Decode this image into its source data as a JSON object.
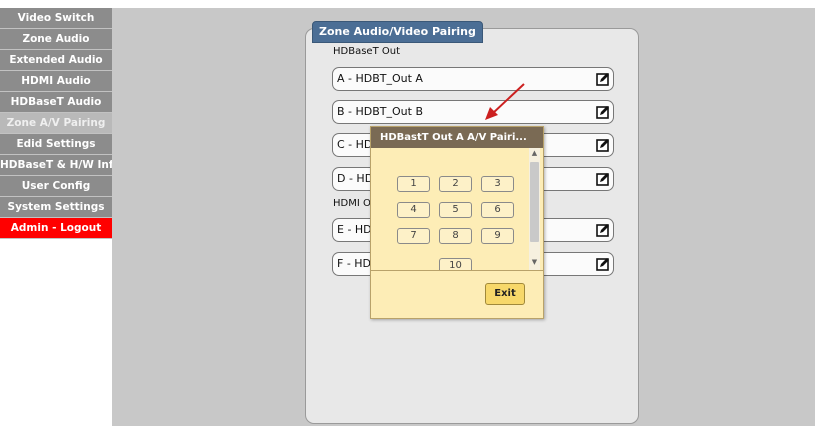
{
  "sidebar": {
    "items": [
      {
        "label": "Video Switch"
      },
      {
        "label": "Zone Audio"
      },
      {
        "label": "Extended Audio"
      },
      {
        "label": "HDMI Audio"
      },
      {
        "label": "HDBaseT Audio"
      },
      {
        "label": "Zone A/V Pairing",
        "active": true
      },
      {
        "label": "Edid Settings"
      },
      {
        "label": "HDBaseT & H/W Info"
      },
      {
        "label": "User Config"
      },
      {
        "label": "System Settings"
      },
      {
        "label": "Admin - Logout"
      }
    ]
  },
  "panel": {
    "title": "Zone Audio/Video Pairing",
    "hdbaset_section": "HDBaseT Out",
    "hdmi_section": "HDMI Ou",
    "rows": [
      {
        "label": "A - HDBT_Out A"
      },
      {
        "label": "B - HDBT_Out B"
      },
      {
        "label": "C - HDI"
      },
      {
        "label": "D - HDI"
      },
      {
        "label": "E - HD/"
      },
      {
        "label": "F - HD/"
      }
    ]
  },
  "popup": {
    "title": "HDBastT Out A A/V Pairi...",
    "buttons": [
      "1",
      "2",
      "3",
      "4",
      "5",
      "6",
      "7",
      "8",
      "9",
      "10"
    ],
    "exit_label": "Exit"
  },
  "colors": {
    "sidebar_bg": "#8c8c8c",
    "logout_bg": "#ff0000",
    "tab_bg": "#4b6e95",
    "popup_bg": "#fdedb6",
    "popup_header": "#7a6a54",
    "exit_bg": "#f7d86a",
    "arrow": "#cc2020"
  },
  "icons": {
    "edit": "edit-icon",
    "arrow": "red-pointer-arrow"
  }
}
